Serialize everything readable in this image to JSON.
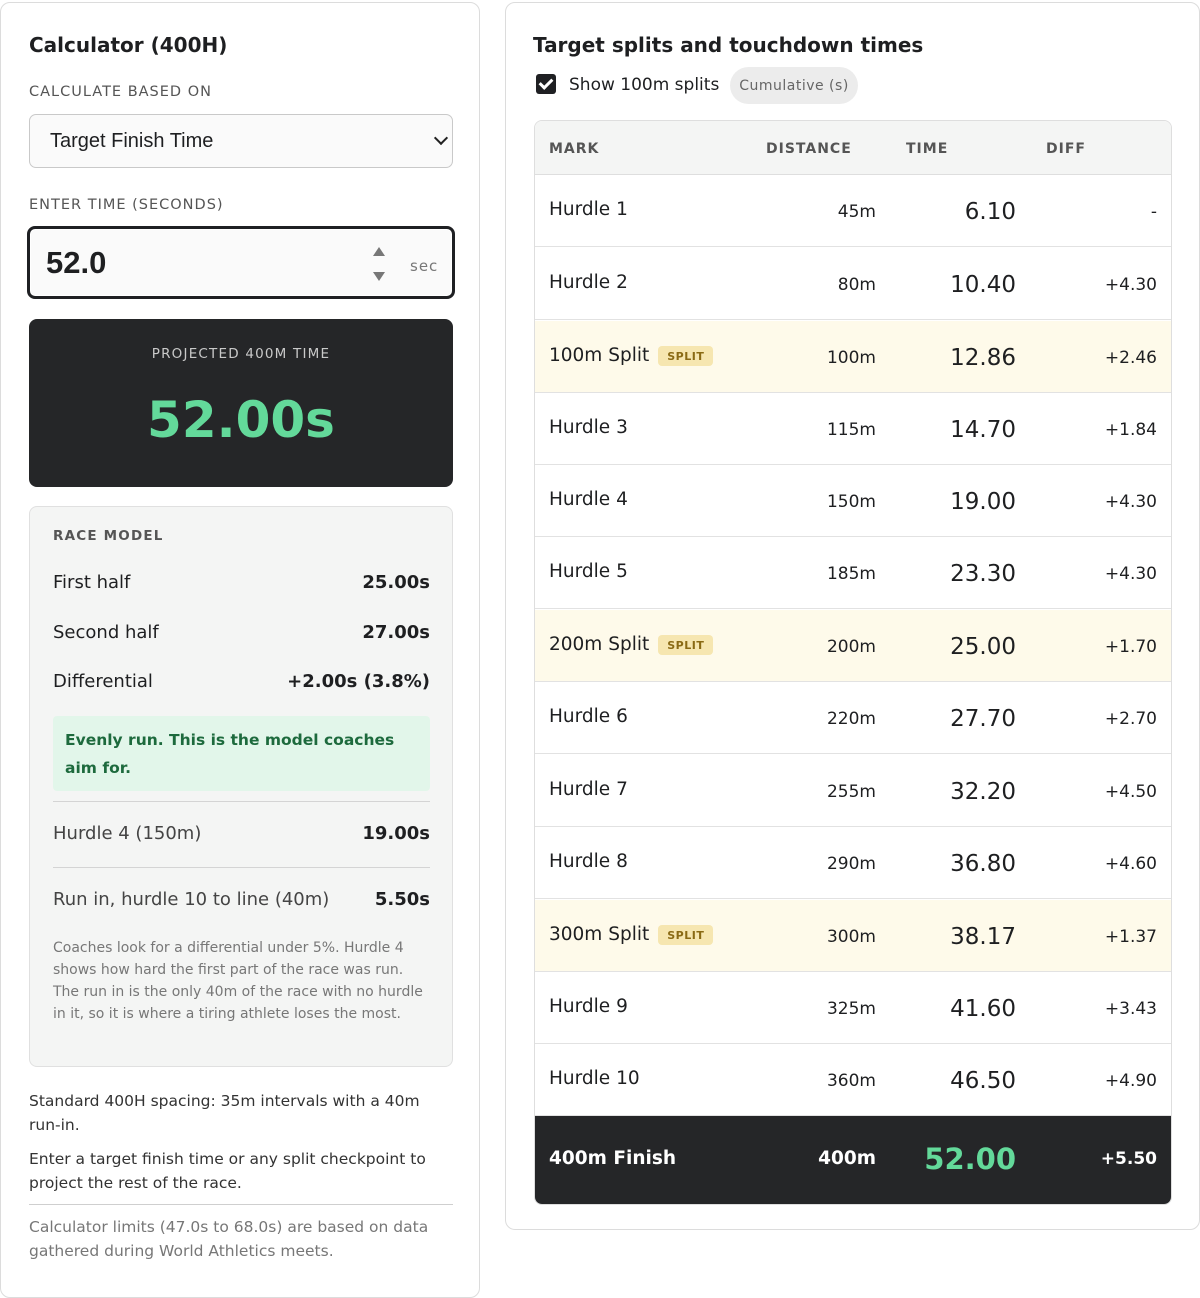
{
  "calculator": {
    "title": "Calculator (400H)",
    "based_on_label": "CALCULATE BASED ON",
    "based_on_value": "Target Finish Time",
    "time_label": "ENTER TIME (SECONDS)",
    "time_value": "52.0",
    "time_unit": "sec"
  },
  "projected": {
    "caption": "PROJECTED 400M TIME",
    "value": "52.00s"
  },
  "model": {
    "heading": "RACE MODEL",
    "first_half_label": "First half",
    "first_half_value": "25.00s",
    "second_half_label": "Second half",
    "second_half_value": "27.00s",
    "diff_label": "Differential",
    "diff_value": "+2.00s (3.8%)",
    "note": "Evenly run. This is the model coaches aim for.",
    "hurdle4_label": "Hurdle 4 (150m)",
    "hurdle4_value": "19.00s",
    "runin_label": "Run in, hurdle 10 to line (40m)",
    "runin_value": "5.50s",
    "explain": "Coaches look for a differential under 5%. Hurdle 4 shows how hard the first part of the race was run. The run in is the only 40m of the race with no hurdle in it, so it is where a tiring athlete loses the most."
  },
  "footer": {
    "spacing": "Standard 400H spacing: 35m intervals with a 40m run-in.",
    "instructions": "Enter a target finish time or any split checkpoint to project the rest of the race.",
    "limits": "Calculator limits (47.0s to 68.0s) are based on data gathered during World Athletics meets."
  },
  "splits": {
    "title": "Target splits and touchdown times",
    "show_label": "Show 100m splits",
    "mode_pill": "Cumulative (s)",
    "columns": [
      "MARK",
      "DISTANCE",
      "TIME",
      "DIFF"
    ],
    "split_badge": "SPLIT",
    "rows": [
      {
        "mark": "Hurdle 1",
        "distance": "45m",
        "time": "6.10",
        "diff": "-",
        "split": false
      },
      {
        "mark": "Hurdle 2",
        "distance": "80m",
        "time": "10.40",
        "diff": "+4.30",
        "split": false
      },
      {
        "mark": "100m Split",
        "distance": "100m",
        "time": "12.86",
        "diff": "+2.46",
        "split": true
      },
      {
        "mark": "Hurdle 3",
        "distance": "115m",
        "time": "14.70",
        "diff": "+1.84",
        "split": false
      },
      {
        "mark": "Hurdle 4",
        "distance": "150m",
        "time": "19.00",
        "diff": "+4.30",
        "split": false
      },
      {
        "mark": "Hurdle 5",
        "distance": "185m",
        "time": "23.30",
        "diff": "+4.30",
        "split": false
      },
      {
        "mark": "200m Split",
        "distance": "200m",
        "time": "25.00",
        "diff": "+1.70",
        "split": true
      },
      {
        "mark": "Hurdle 6",
        "distance": "220m",
        "time": "27.70",
        "diff": "+2.70",
        "split": false
      },
      {
        "mark": "Hurdle 7",
        "distance": "255m",
        "time": "32.20",
        "diff": "+4.50",
        "split": false
      },
      {
        "mark": "Hurdle 8",
        "distance": "290m",
        "time": "36.80",
        "diff": "+4.60",
        "split": false
      },
      {
        "mark": "300m Split",
        "distance": "300m",
        "time": "38.17",
        "diff": "+1.37",
        "split": true
      },
      {
        "mark": "Hurdle 9",
        "distance": "325m",
        "time": "41.60",
        "diff": "+3.43",
        "split": false
      },
      {
        "mark": "Hurdle 10",
        "distance": "360m",
        "time": "46.50",
        "diff": "+4.90",
        "split": false
      }
    ],
    "finish": {
      "mark": "400m Finish",
      "distance": "400m",
      "time": "52.00",
      "diff": "+5.50"
    }
  },
  "colors": {
    "accent_green": "#63d99a",
    "dark": "#252628",
    "split_bg": "#fefaea",
    "note_bg": "#e2f6ea"
  }
}
